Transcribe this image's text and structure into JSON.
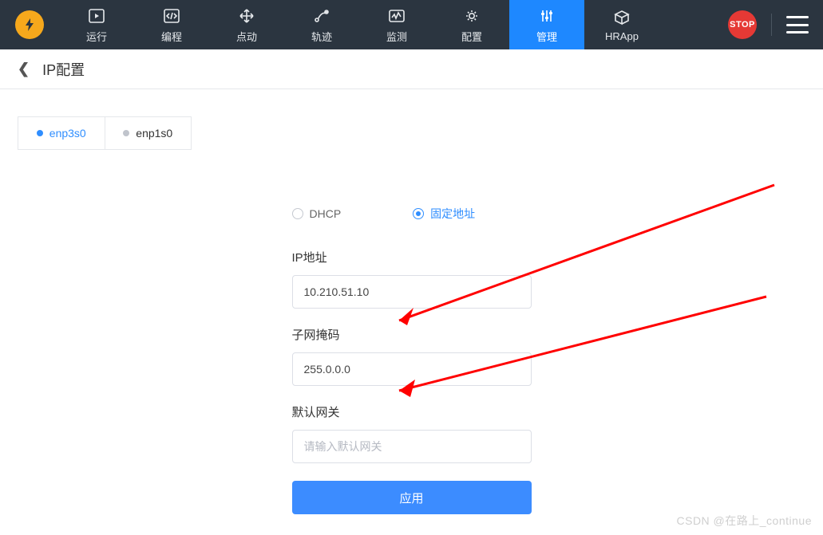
{
  "nav": {
    "items": [
      {
        "label": "运行"
      },
      {
        "label": "编程"
      },
      {
        "label": "点动"
      },
      {
        "label": "轨迹"
      },
      {
        "label": "监测"
      },
      {
        "label": "配置"
      },
      {
        "label": "管理"
      },
      {
        "label": "HRApp"
      }
    ],
    "stop_label": "STOP"
  },
  "header": {
    "title": "IP配置"
  },
  "tabs": [
    {
      "label": "enp3s0"
    },
    {
      "label": "enp1s0"
    }
  ],
  "form": {
    "radio_dhcp": "DHCP",
    "radio_static": "固定地址",
    "ip_label": "IP地址",
    "ip_value": "10.210.51.10",
    "mask_label": "子网掩码",
    "mask_value": "255.0.0.0",
    "gateway_label": "默认网关",
    "gateway_value": "",
    "gateway_placeholder": "请输入默认网关",
    "apply_label": "应用"
  },
  "watermark": "CSDN @在路上_continue"
}
